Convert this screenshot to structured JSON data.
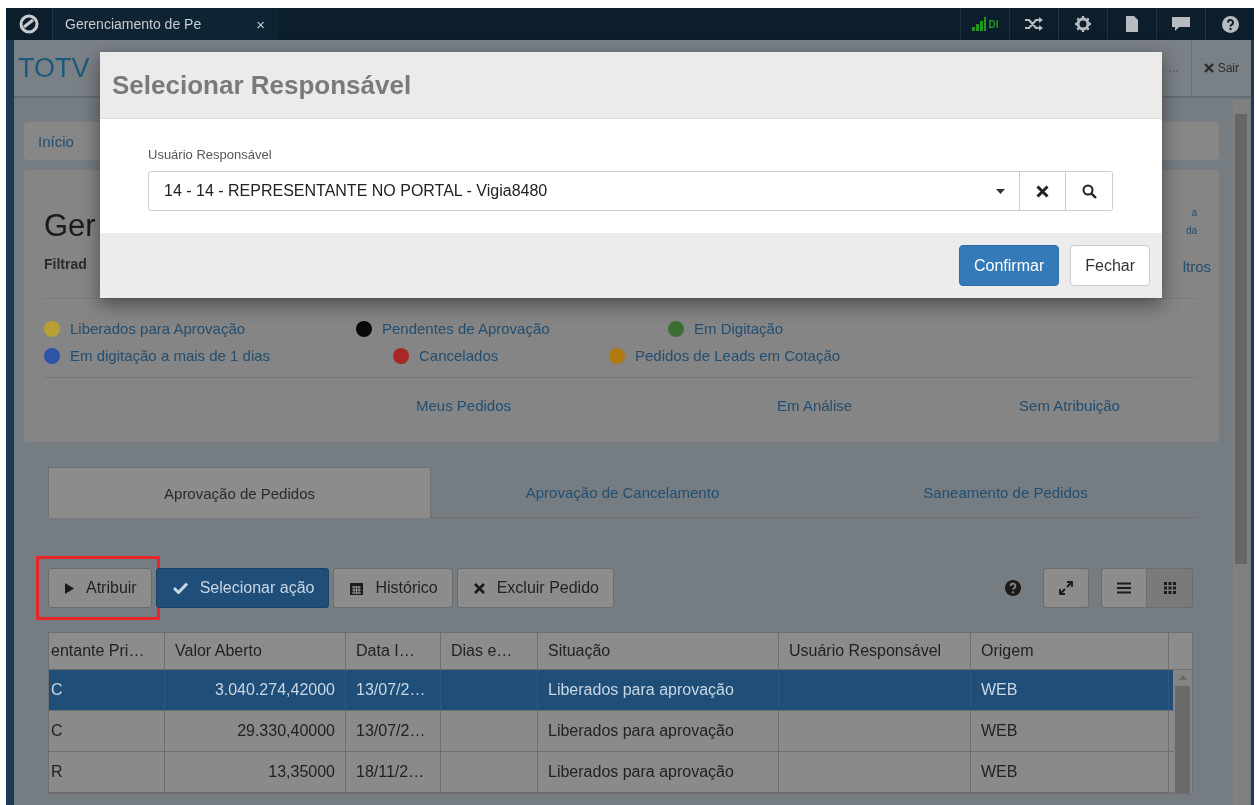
{
  "topbar": {
    "tab_title": "Gerenciamento de Pe",
    "tab_close": "×",
    "signal_label": "DI"
  },
  "header": {
    "brand": "TOTV",
    "ellipsis": "...",
    "logout": "Sair"
  },
  "breadcrumb": {
    "home": "Início"
  },
  "page": {
    "title": "Ger",
    "filter_label": "Filtrad",
    "right_texts": [
      "a",
      "da",
      "ltros"
    ]
  },
  "legend": [
    {
      "label": "Liberados para Aprovação",
      "color": "#b8a032"
    },
    {
      "label": "Pendentes de Aprovação",
      "color": "#0a0a0a"
    },
    {
      "label": "Em Digitação",
      "color": "#3c6e34"
    },
    {
      "label": "Em digitação a mais de 1 dias",
      "color": "#2e54a8"
    },
    {
      "label": "Cancelados",
      "color": "#a82828"
    },
    {
      "label": "Pedidos de Leads em Cotação",
      "color": "#b07a10"
    }
  ],
  "filters": [
    "Meus Pedidos",
    "Em Análise",
    "Sem Atribuição"
  ],
  "tabs": [
    {
      "label": "Aprovação de Pedidos",
      "selected": true
    },
    {
      "label": "Aprovação de Cancelamento",
      "selected": false
    },
    {
      "label": "Saneamento de Pedidos",
      "selected": false
    }
  ],
  "toolbar": [
    {
      "label": "Atribuir",
      "kind": "play",
      "highlighted": true
    },
    {
      "label": "Selecionar ação",
      "kind": "check",
      "highlighted": false
    },
    {
      "label": "Histórico",
      "kind": "calendar",
      "highlighted": false
    },
    {
      "label": "Excluir Pedido",
      "kind": "delete",
      "highlighted": false
    }
  ],
  "view_modes": [
    {
      "kind": "list",
      "selected": false
    },
    {
      "kind": "grid",
      "selected": true
    }
  ],
  "table": {
    "columns": [
      "entante Pri…",
      "Valor Aberto",
      "Data I…",
      "Dias e…",
      "Situação",
      "Usuário Responsável",
      "Origem"
    ],
    "rows": [
      {
        "selected": true,
        "column_1": "C",
        "valor_aberto": "3.040.274,42000",
        "data": "13/07/2…",
        "situacao": "Liberados para aprovação",
        "origem": "WEB"
      },
      {
        "selected": false,
        "column_1": "C",
        "valor_aberto": "29.330,40000",
        "data": "13/07/2…",
        "situacao": "Liberados para aprovação",
        "origem": "WEB"
      },
      {
        "selected": false,
        "column_1": "R",
        "valor_aberto": "13,35000",
        "data": "18/11/2…",
        "situacao": "Liberados para aprovação",
        "origem": "WEB"
      }
    ]
  },
  "modal": {
    "title": "Selecionar Responsável",
    "field_label": "Usuário Responsável",
    "field_value": "14 - 14 - REPRESENTANTE NO PORTAL - Vigia8480",
    "buttons": [
      {
        "label": "Confirmar",
        "kind": "primary"
      },
      {
        "label": "Fechar",
        "kind": "default"
      }
    ]
  }
}
